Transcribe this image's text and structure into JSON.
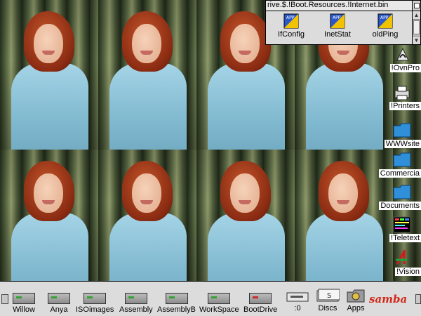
{
  "filer": {
    "title": "rive.$.!Boot.Resources.!Internet.bin",
    "items": [
      {
        "label": "IfConfig",
        "icon": "app-icon"
      },
      {
        "label": "InetStat",
        "icon": "app-icon"
      },
      {
        "label": "oldPing",
        "icon": "app-icon"
      }
    ],
    "app_icon_text": "APP"
  },
  "pinboard": [
    {
      "label": "!OvnPro",
      "icon": "ovation-pro-icon"
    },
    {
      "label": "!Printers",
      "icon": "printer-icon"
    },
    {
      "label": "WWWsite",
      "icon": "folder-icon"
    },
    {
      "label": "Commercia",
      "icon": "folder-icon"
    },
    {
      "label": "Documents",
      "icon": "folder-icon"
    },
    {
      "label": "!Teletext",
      "icon": "teletext-icon"
    },
    {
      "label": "!Vision",
      "icon": "vision-icon"
    }
  ],
  "iconbar": {
    "drives": [
      "Willow",
      "Anya",
      "ISOimages",
      "Assembly",
      "AssemblyB",
      "WorkSpace",
      "BootDrive"
    ],
    "misc": [
      ":0",
      "Discs",
      "Apps"
    ],
    "samba_label": "samba",
    "discs_icon_text": "S"
  },
  "colors": {
    "folder": "#2f8fd8",
    "iconbar_bg": "#dcdcdc",
    "filer_bg": "#dddddd"
  }
}
